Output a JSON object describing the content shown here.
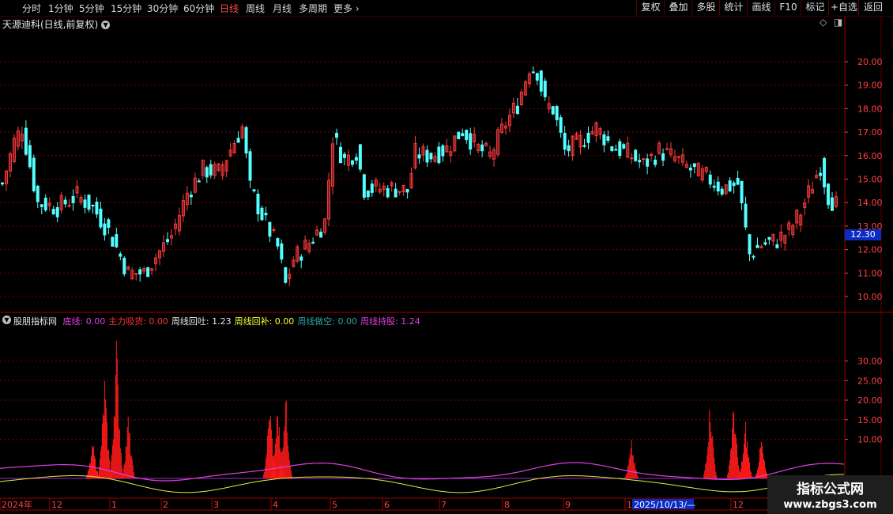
{
  "toolbar": {
    "periods": [
      "分时",
      "1分钟",
      "5分钟",
      "15分钟",
      "30分钟",
      "60分钟",
      "日线",
      "周线",
      "月线",
      "多周期",
      "更多"
    ],
    "active_period": "日线",
    "buttons": [
      "复权",
      "叠加",
      "多股",
      "统计",
      "画线",
      "F10",
      "标记",
      "+自选",
      "返回"
    ]
  },
  "main_panel": {
    "title": "天源迪科(日线,前复权)",
    "price_tag": "12.30"
  },
  "indicator_panel": {
    "name": "股朋指标网",
    "items": [
      {
        "label": "底线",
        "value": "0.00",
        "color": "#e040e0"
      },
      {
        "label": "主力吸货",
        "value": "0.00",
        "color": "#ff3030"
      },
      {
        "label": "周线回吐",
        "value": "1.23",
        "color": "#e8e8e8"
      },
      {
        "label": "周线回补",
        "value": "0.00",
        "color": "#ffff30"
      },
      {
        "label": "周线做空",
        "value": "0.00",
        "color": "#30a0a0"
      },
      {
        "label": "周线持股",
        "value": "1.24",
        "color": "#e040e0"
      }
    ]
  },
  "x_axis": {
    "labels": [
      "2024年",
      "12",
      "1",
      "2",
      "3",
      "4",
      "5",
      "6",
      "7",
      "8",
      "9",
      "10",
      "11",
      "12"
    ],
    "cursor_date": "2025/10/13/—"
  },
  "watermark": {
    "name": "指标公式网",
    "url": "www.zbgs3.com"
  },
  "colors": {
    "up": "#ff3b3b",
    "down": "#54ffff",
    "grid": "#7a0000",
    "axis": "#ff4040",
    "price_tag_bg": "#0b2cc4"
  },
  "chart_data": [
    {
      "type": "candlestick",
      "y_ticks": [
        10.0,
        11.0,
        12.0,
        13.0,
        14.0,
        15.0,
        16.0,
        17.0,
        18.0,
        19.0,
        20.0
      ],
      "ylim": [
        9.6,
        21.6
      ],
      "close_path": [
        [
          0,
          14.8
        ],
        [
          3,
          16.6
        ],
        [
          5,
          17.2
        ],
        [
          9,
          14.0
        ],
        [
          14,
          13.8
        ],
        [
          19,
          14.3
        ],
        [
          23,
          13.8
        ],
        [
          27,
          12.8
        ],
        [
          32,
          11.0
        ],
        [
          36,
          11.0
        ],
        [
          39,
          11.7
        ],
        [
          43,
          12.6
        ],
        [
          47,
          14.4
        ],
        [
          51,
          15.4
        ],
        [
          55,
          15.3
        ],
        [
          59,
          16.6
        ],
        [
          61,
          17.2
        ],
        [
          63,
          14.6
        ],
        [
          67,
          13.1
        ],
        [
          70,
          12.1
        ],
        [
          72,
          10.5
        ],
        [
          74,
          11.6
        ],
        [
          78,
          12.3
        ],
        [
          82,
          13.2
        ],
        [
          84,
          16.8
        ],
        [
          87,
          15.8
        ],
        [
          90,
          16.2
        ],
        [
          92,
          14.6
        ],
        [
          96,
          14.6
        ],
        [
          100,
          14.6
        ],
        [
          103,
          14.5
        ],
        [
          105,
          16.1
        ],
        [
          109,
          16.0
        ],
        [
          113,
          16.3
        ],
        [
          117,
          17.1
        ],
        [
          121,
          16.3
        ],
        [
          124,
          16.0
        ],
        [
          128,
          17.4
        ],
        [
          131,
          18.2
        ],
        [
          134,
          19.8
        ],
        [
          136,
          19.6
        ],
        [
          138,
          18.2
        ],
        [
          140,
          18.0
        ],
        [
          143,
          16.2
        ],
        [
          147,
          16.6
        ],
        [
          151,
          17.2
        ],
        [
          155,
          16.4
        ],
        [
          159,
          16.1
        ],
        [
          163,
          15.6
        ],
        [
          167,
          16.2
        ],
        [
          171,
          15.9
        ],
        [
          175,
          15.4
        ],
        [
          179,
          15.1
        ],
        [
          183,
          14.6
        ],
        [
          187,
          14.8
        ],
        [
          190,
          11.8
        ],
        [
          193,
          12.2
        ],
        [
          197,
          12.4
        ],
        [
          200,
          12.8
        ],
        [
          203,
          13.6
        ],
        [
          206,
          14.8
        ],
        [
          208,
          15.6
        ],
        [
          210,
          14.3
        ],
        [
          212,
          13.9
        ]
      ],
      "series_names": []
    },
    {
      "type": "bar",
      "y_ticks": [
        10.0,
        15.0,
        20.0,
        25.0,
        30.0
      ],
      "ylim": [
        0,
        40
      ],
      "spikes": [
        [
          23,
          10
        ],
        [
          26,
          27
        ],
        [
          29,
          38
        ],
        [
          32,
          17
        ],
        [
          68,
          21
        ],
        [
          70,
          20
        ],
        [
          72,
          24
        ],
        [
          160,
          10
        ],
        [
          180,
          22
        ],
        [
          186,
          21
        ],
        [
          189,
          15
        ],
        [
          193,
          11
        ]
      ],
      "lines": [
        "周线持股",
        "周线回吐"
      ]
    }
  ]
}
